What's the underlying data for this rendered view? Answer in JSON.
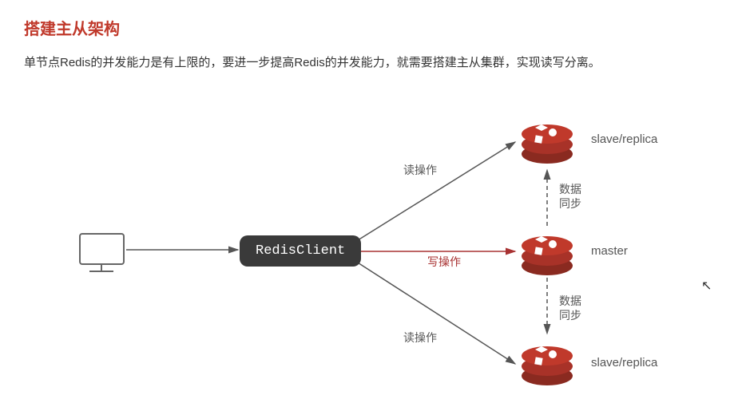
{
  "title": "搭建主从架构",
  "description": "单节点Redis的并发能力是有上限的，要进一步提高Redis的并发能力，就需要搭建主从集群，实现读写分离。",
  "diagram": {
    "client_label": "RedisClient",
    "nodes": {
      "slave_top": "slave/replica",
      "master": "master",
      "slave_bottom": "slave/replica"
    },
    "edges": {
      "read_top": "读操作",
      "write": "写操作",
      "read_bottom": "读操作",
      "sync_top_line1": "数据",
      "sync_top_line2": "同步",
      "sync_bottom_line1": "数据",
      "sync_bottom_line2": "同步"
    }
  },
  "colors": {
    "title": "#C0392B",
    "redis": "#C0392B",
    "write_line": "#a83232",
    "line": "#555"
  }
}
